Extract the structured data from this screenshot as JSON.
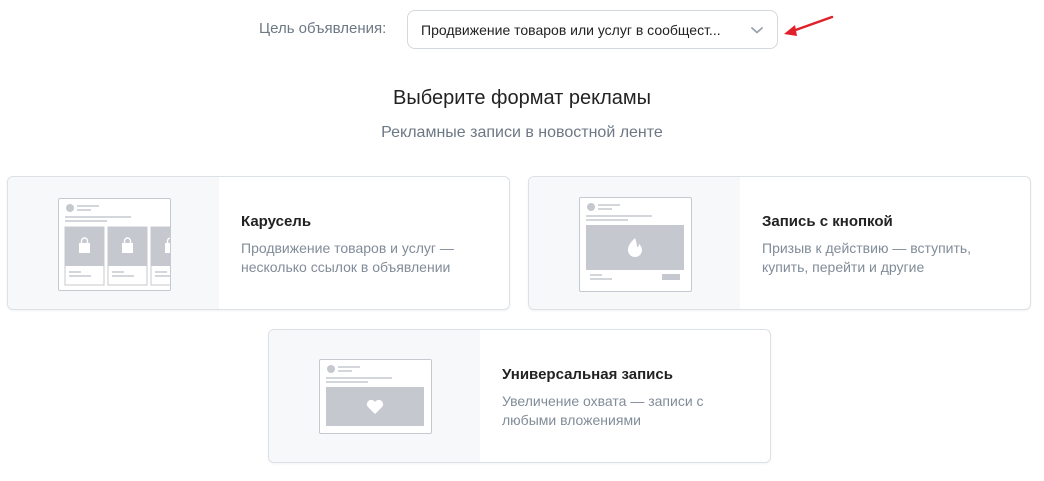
{
  "goal": {
    "label": "Цель объявления:",
    "value": "Продвижение товаров или услуг в сообщест...",
    "annotation_arrow_color": "#e0202a"
  },
  "heading": {
    "title": "Выберите формат рекламы",
    "subtitle": "Рекламные записи в новостной ленте"
  },
  "formats": [
    {
      "title": "Карусель",
      "description": "Продвижение товаров и услуг — несколько ссылок в объявлении",
      "icon": "shopping-bag-icon"
    },
    {
      "title": "Запись с кнопкой",
      "description": "Призыв к действию — вступить, купить, перейти и другие",
      "icon": "fire-icon"
    },
    {
      "title": "Универсальная запись",
      "description": "Увеличение охвата — записи с любыми вложениями",
      "icon": "heart-icon"
    }
  ],
  "colors": {
    "placeholder_gray": "#c5c8ce",
    "line_gray": "#d3d6db",
    "preview_bg": "#f7f8fa",
    "text_secondary": "#818c99"
  }
}
